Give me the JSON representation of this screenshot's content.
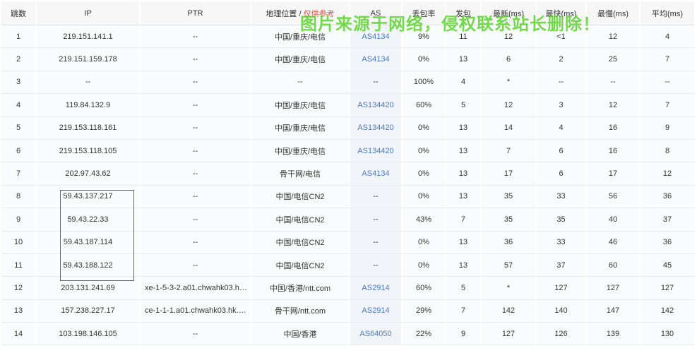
{
  "headers": {
    "hop": "跳数",
    "ip": "IP",
    "ptr": "PTR",
    "geo": "地理位置 / ",
    "geo_note": "仅供参考",
    "as": "AS",
    "loss": "丢包率",
    "sent": "发包",
    "last": "最新(ms)",
    "best": "最快(ms)",
    "worst": "最慢(ms)",
    "avg": "平均(ms)"
  },
  "rows": [
    {
      "hop": "1",
      "ip": "219.151.141.1",
      "ptr": "--",
      "geo": "中国/重庆/电信",
      "as": "AS4134",
      "loss": "9%",
      "sent": "11",
      "last": "12",
      "best": "<1",
      "worst": "12",
      "avg": "4"
    },
    {
      "hop": "2",
      "ip": "219.151.159.178",
      "ptr": "--",
      "geo": "中国/重庆/电信",
      "as": "AS4134",
      "loss": "0%",
      "sent": "13",
      "last": "6",
      "best": "2",
      "worst": "25",
      "avg": "7"
    },
    {
      "hop": "3",
      "ip": "--",
      "ptr": "--",
      "geo": "--",
      "as": "--",
      "loss": "100%",
      "sent": "4",
      "last": "*",
      "best": "--",
      "worst": "--",
      "avg": "--"
    },
    {
      "hop": "4",
      "ip": "119.84.132.9",
      "ptr": "--",
      "geo": "中国/重庆/电信",
      "as": "AS134420",
      "loss": "60%",
      "sent": "5",
      "last": "12",
      "best": "3",
      "worst": "12",
      "avg": "7"
    },
    {
      "hop": "5",
      "ip": "219.153.118.161",
      "ptr": "--",
      "geo": "中国/重庆/电信",
      "as": "AS134420",
      "loss": "0%",
      "sent": "13",
      "last": "14",
      "best": "4",
      "worst": "16",
      "avg": "9"
    },
    {
      "hop": "6",
      "ip": "219.153.118.105",
      "ptr": "--",
      "geo": "中国/重庆/电信",
      "as": "AS134420",
      "loss": "0%",
      "sent": "13",
      "last": "7",
      "best": "6",
      "worst": "16",
      "avg": "8"
    },
    {
      "hop": "7",
      "ip": "202.97.43.62",
      "ptr": "--",
      "geo": "骨干网/电信",
      "as": "AS4134",
      "loss": "0%",
      "sent": "13",
      "last": "17",
      "best": "6",
      "worst": "17",
      "avg": "12"
    },
    {
      "hop": "8",
      "ip": "59.43.137.217",
      "ptr": "--",
      "geo": "中国/电信CN2",
      "as": "--",
      "loss": "0%",
      "sent": "13",
      "last": "35",
      "best": "33",
      "worst": "56",
      "avg": "36"
    },
    {
      "hop": "9",
      "ip": "59.43.22.33",
      "ptr": "--",
      "geo": "中国/电信CN2",
      "as": "--",
      "loss": "43%",
      "sent": "7",
      "last": "35",
      "best": "35",
      "worst": "40",
      "avg": "37"
    },
    {
      "hop": "10",
      "ip": "59.43.187.114",
      "ptr": "--",
      "geo": "中国/电信CN2",
      "as": "--",
      "loss": "0%",
      "sent": "13",
      "last": "36",
      "best": "33",
      "worst": "46",
      "avg": "36"
    },
    {
      "hop": "11",
      "ip": "59.43.188.122",
      "ptr": "--",
      "geo": "中国/电信CN2",
      "as": "--",
      "loss": "0%",
      "sent": "13",
      "last": "57",
      "best": "37",
      "worst": "60",
      "avg": "45"
    },
    {
      "hop": "12",
      "ip": "203.131.241.69",
      "ptr": "xe-1-5-3-2.a01.chwahk03.hk....",
      "geo": "中国/香港/ntt.com",
      "as": "AS2914",
      "loss": "60%",
      "sent": "5",
      "last": "*",
      "best": "127",
      "worst": "127",
      "avg": "127"
    },
    {
      "hop": "13",
      "ip": "157.238.227.17",
      "ptr": "ce-1-1-1.a01.chwahk03.hk.ce...",
      "geo": "骨干网/ntt.com",
      "as": "AS2914",
      "loss": "29%",
      "sent": "7",
      "last": "142",
      "best": "140",
      "worst": "147",
      "avg": "142"
    },
    {
      "hop": "14",
      "ip": "103.198.146.105",
      "ptr": "--",
      "geo": "中国/香港",
      "as": "AS64050",
      "loss": "22%",
      "sent": "9",
      "last": "127",
      "best": "126",
      "worst": "139",
      "avg": "130"
    }
  ],
  "watermark": "图片来源于网络，侵权联系站长删除！",
  "colors": {
    "as_link": "#4a77c4",
    "geo_note": "#e0524a",
    "highlight_box": "#d9332c",
    "watermark": "#4fd11d"
  }
}
